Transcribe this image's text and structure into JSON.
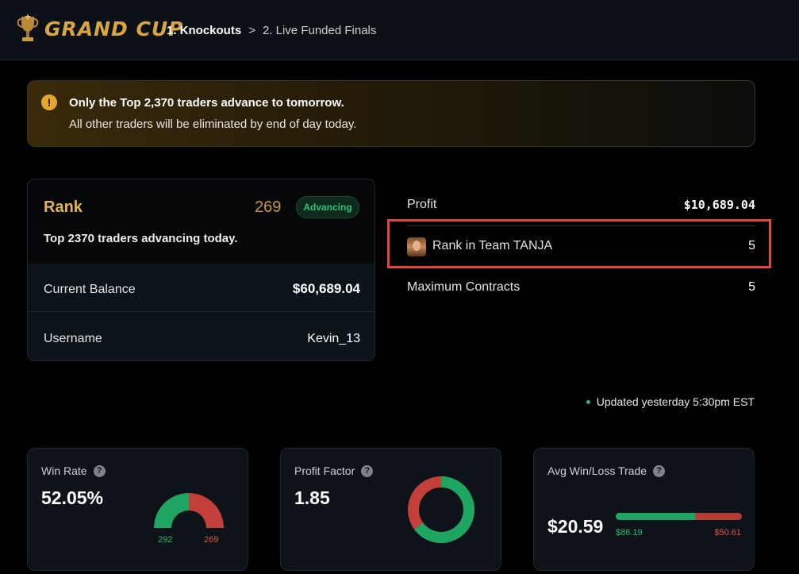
{
  "header": {
    "brand": "GRAND CUP",
    "breadcrumb": [
      "1. Knockouts",
      ">",
      "2. Live Funded Finals"
    ]
  },
  "banner": {
    "title": "Only the Top 2,370 traders advance to tomorrow.",
    "subtitle": "All other traders will be eliminated by end of day today."
  },
  "rank_card": {
    "label": "Rank",
    "rank": "269",
    "badge": "Advancing",
    "description": "Top 2370 traders advancing today.",
    "rows": [
      {
        "label": "Current Balance",
        "value": "$60,689.04"
      },
      {
        "label": "Username",
        "value": "Kevin_13"
      }
    ]
  },
  "stats": {
    "profit": {
      "label": "Profit",
      "value": "$10,689.04"
    },
    "team_rank": {
      "label": "Rank in Team TANJA",
      "value": "5"
    },
    "max_contracts": {
      "label": "Maximum Contracts",
      "value": "5"
    }
  },
  "updated": "Updated yesterday 5:30pm EST",
  "metrics": {
    "win_rate": {
      "title": "Win Rate",
      "value": "52.05%",
      "wins": "292",
      "losses": "269"
    },
    "profit_factor": {
      "title": "Profit Factor",
      "value": "1.85"
    },
    "avg_trade": {
      "title": "Avg Win/Loss Trade",
      "value": "$20.59",
      "avg_win": "$86.19",
      "avg_loss": "$50.61"
    }
  },
  "colors": {
    "accent": "#d9a441",
    "win": "#1fa562",
    "loss": "#c23f3a",
    "highlight": "#e0453f"
  },
  "icons": {
    "logo": "trophy-icon",
    "warning": "warning-icon",
    "help": "question-icon"
  }
}
